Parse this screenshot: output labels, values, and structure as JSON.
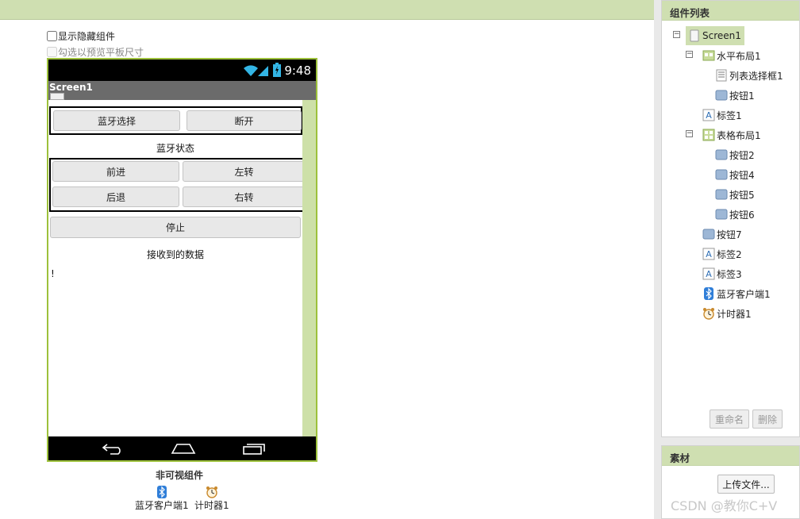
{
  "viewer": {
    "show_hidden_label": "显示隐藏组件",
    "tablet_preview_label": "勾选以预览平板尺寸"
  },
  "phone": {
    "status_time": "9:48",
    "screen_title": "Screen1",
    "btn_bt_select": "蓝牙选择",
    "btn_disconnect": "断开",
    "label_bt_status": "蓝牙状态",
    "btn_forward": "前进",
    "btn_left": "左转",
    "btn_back": "后退",
    "btn_right": "右转",
    "btn_stop": "停止",
    "label_received": "接收到的数据",
    "label_exclaim": "!"
  },
  "nonvisible": {
    "title": "非可视组件",
    "items": [
      {
        "label": "蓝牙客户端1",
        "icon": "bluetooth-icon"
      },
      {
        "label": "计时器1",
        "icon": "clock-icon"
      }
    ]
  },
  "components": {
    "header": "组件列表",
    "tree": [
      {
        "label": "Screen1",
        "icon": "screen-icon"
      },
      {
        "label": "水平布局1",
        "icon": "horizontal-arrangement-icon"
      },
      {
        "label": "列表选择框1",
        "icon": "listpicker-icon"
      },
      {
        "label": "按钮1",
        "icon": "button-icon"
      },
      {
        "label": "标签1",
        "icon": "label-icon"
      },
      {
        "label": "表格布局1",
        "icon": "table-arrangement-icon"
      },
      {
        "label": "按钮2",
        "icon": "button-icon"
      },
      {
        "label": "按钮4",
        "icon": "button-icon"
      },
      {
        "label": "按钮5",
        "icon": "button-icon"
      },
      {
        "label": "按钮6",
        "icon": "button-icon"
      },
      {
        "label": "按钮7",
        "icon": "button-icon"
      },
      {
        "label": "标签2",
        "icon": "label-icon"
      },
      {
        "label": "标签3",
        "icon": "label-icon"
      },
      {
        "label": "蓝牙客户端1",
        "icon": "bluetooth-icon"
      },
      {
        "label": "计时器1",
        "icon": "clock-icon"
      }
    ],
    "rename_label": "重命名",
    "delete_label": "删除"
  },
  "media": {
    "header": "素材",
    "upload_label": "上传文件..."
  },
  "watermark": "CSDN @教你C+V",
  "colors": {
    "panel_header": "#cfdfb1",
    "phone_border": "#9dc13b",
    "titlebar": "#6b6b6b",
    "scroll_track": "#cde0a8"
  }
}
